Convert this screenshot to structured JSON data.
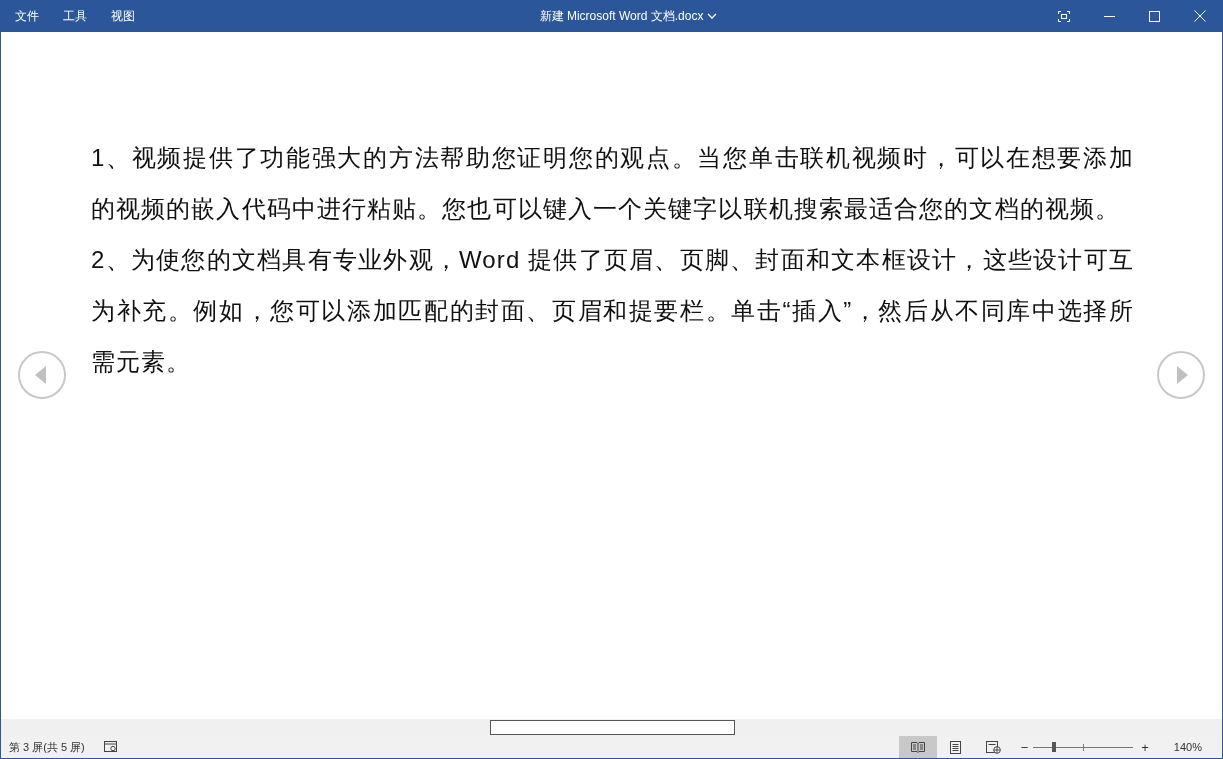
{
  "menu": [
    "文件",
    "工具",
    "视图"
  ],
  "window": {
    "title": "新建 Microsoft Word 文档.docx"
  },
  "paragraphs": [
    "1、视频提供了功能强大的方法帮助您证明您的观点。当您单击联机视频时，可以在想要添加的视频的嵌入代码中进行粘贴。您也可以键入一个关键字以联机搜索最适合您的文档的视频。",
    "2、为使您的文档具有专业外观，Word 提供了页眉、页脚、封面和文本框设计，这些设计可互为补充。例如，您可以添加匹配的封面、页眉和提要栏。单击“插入”，然后从不同库中选择所需元素。"
  ],
  "status_bar": {
    "page": "第 3 屏(共 5 屏)",
    "views": [
      {
        "kind": "read",
        "selected": true
      },
      {
        "kind": "print",
        "selected": false
      },
      {
        "kind": "web",
        "selected": false
      }
    ],
    "zoom": {
      "minus": "−",
      "plus": "+",
      "level": 0.21,
      "reading": "140%"
    }
  }
}
